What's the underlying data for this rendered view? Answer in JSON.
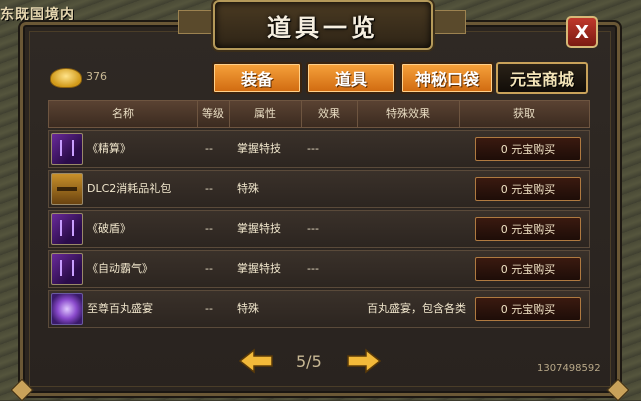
{
  "background": {
    "location_text": "东既国境内"
  },
  "panel": {
    "title": "道具一览",
    "close_label": "X"
  },
  "currency": {
    "icon": "gold-ingot-icon",
    "amount": "376"
  },
  "tabs": [
    {
      "label": "装备",
      "style": "orange"
    },
    {
      "label": "道具",
      "style": "orange"
    },
    {
      "label": "神秘口袋",
      "style": "orange"
    },
    {
      "label": "元宝商城",
      "style": "dark"
    }
  ],
  "table": {
    "headers": [
      "名称",
      "等级",
      "属性",
      "效果",
      "特殊效果",
      "获取"
    ],
    "rows": [
      {
        "icon": "skill-book-icon",
        "name": "《精算》",
        "level": "--",
        "attr": "掌握特技",
        "effect": "---",
        "special": "",
        "buy": "0 元宝购买"
      },
      {
        "icon": "treasure-chest-icon",
        "name": "DLC2消耗品礼包",
        "level": "--",
        "attr": "特殊",
        "effect": "",
        "special": "",
        "buy": "0 元宝购买"
      },
      {
        "icon": "skill-book-icon",
        "name": "《破盾》",
        "level": "--",
        "attr": "掌握特技",
        "effect": "---",
        "special": "",
        "buy": "0 元宝购买"
      },
      {
        "icon": "skill-book-icon",
        "name": "《自动霸气》",
        "level": "--",
        "attr": "掌握特技",
        "effect": "---",
        "special": "",
        "buy": "0 元宝购买"
      },
      {
        "icon": "purple-orb-icon",
        "name": "至尊百丸盛宴",
        "level": "--",
        "attr": "特殊",
        "effect": "",
        "special": "百丸盛宴，包含各类",
        "buy": "0 元宝购买"
      }
    ]
  },
  "pager": {
    "page": "5/5"
  },
  "player_id": "1307498592",
  "colors": {
    "accent_orange": "#e88a22",
    "panel_bg": "#2b2520",
    "gold": "#c9a25a"
  }
}
